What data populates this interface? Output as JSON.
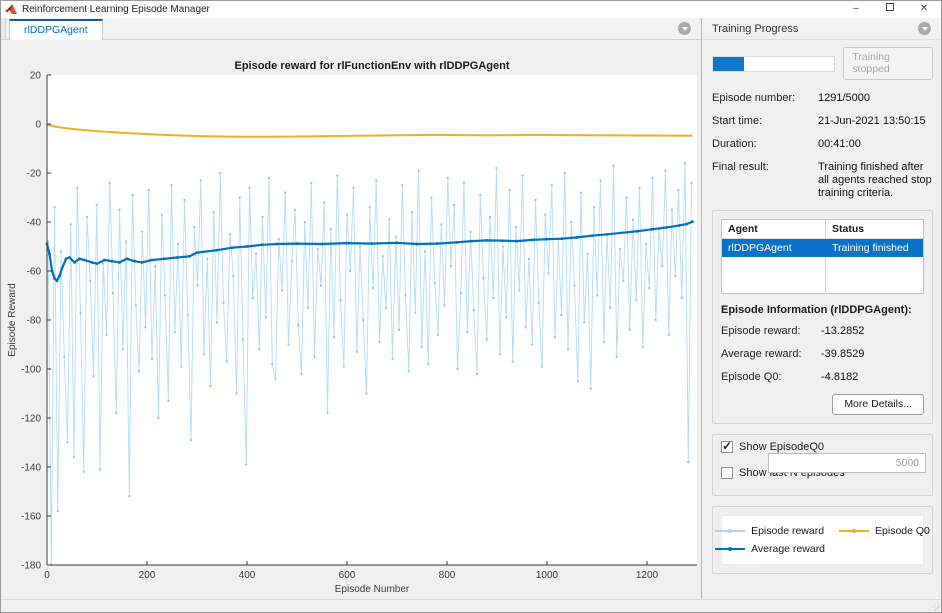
{
  "window": {
    "title": "Reinforcement Learning Episode Manager",
    "controls": {
      "minimize": "–",
      "close": "✕"
    }
  },
  "tabs": [
    {
      "label": "rlDDPGAgent"
    }
  ],
  "chart_data": {
    "type": "line",
    "title": "Episode reward for rlFunctionEnv with rlDDPGAgent",
    "xlabel": "Episode Number",
    "ylabel": "Episode Reward",
    "xlim": [
      0,
      1300
    ],
    "ylim": [
      -180,
      20
    ],
    "x_ticks": [
      0,
      200,
      400,
      600,
      800,
      1000,
      1200
    ],
    "y_ticks": [
      20,
      0,
      -20,
      -40,
      -60,
      -80,
      -100,
      -120,
      -140,
      -160,
      -180
    ],
    "grid": false,
    "legend_position": "right-panel",
    "series": [
      {
        "name": "Episode reward",
        "style": "line-with-markers",
        "x_start": 2,
        "x_step": 6.5,
        "values": [
          -48,
          -180,
          -34,
          -158,
          -52,
          -95,
          -130,
          -41,
          -136,
          -26,
          -77,
          -142,
          -38,
          -64,
          -103,
          -33,
          -141,
          -57,
          -86,
          -24,
          -69,
          -118,
          -35,
          -92,
          -48,
          -152,
          -29,
          -74,
          -101,
          -44,
          -83,
          -27,
          -96,
          -58,
          -120,
          -37,
          -70,
          -113,
          -25,
          -85,
          -49,
          -99,
          -31,
          -78,
          -129,
          -42,
          -66,
          -23,
          -94,
          -55,
          -107,
          -36,
          -81,
          -20,
          -73,
          -97,
          -45,
          -62,
          -110,
          -30,
          -88,
          -139,
          -26,
          -71,
          -53,
          -92,
          -38,
          -79,
          -22,
          -98,
          -104,
          -47,
          -68,
          -28,
          -90,
          -56,
          -35,
          -82,
          -102,
          -40,
          -75,
          -24,
          -95,
          -51,
          -66,
          -32,
          -118,
          -43,
          -87,
          -21,
          -72,
          -99,
          -37,
          -60,
          -26,
          -93,
          -50,
          -80,
          -110,
          -34,
          -67,
          -23,
          -89,
          -54,
          -75,
          -39,
          -96,
          -46,
          -84,
          -25,
          -70,
          -101,
          -36,
          -77,
          -19,
          -91,
          -52,
          -98,
          -30,
          -65,
          -86,
          -41,
          -74,
          -22,
          -58,
          -33,
          -100,
          -69,
          -24,
          -85,
          -44,
          -76,
          -102,
          -29,
          -63,
          -88,
          -38,
          -71,
          -18,
          -94,
          -50,
          -79,
          -27,
          -97,
          -42,
          -68,
          -21,
          -83,
          -55,
          -90,
          -31,
          -73,
          -99,
          -37,
          -61,
          -25,
          -87,
          -47,
          -78,
          -20,
          -92,
          -40,
          -66,
          -105,
          -28,
          -81,
          -53,
          -108,
          -34,
          -70,
          -23,
          -89,
          -45,
          -75,
          -17,
          -95,
          -51,
          -64,
          -30,
          -84,
          -39,
          -72,
          -26,
          -91,
          -49,
          -67,
          -22,
          -80,
          -43,
          -58,
          -19,
          -86,
          -35,
          -62,
          -27,
          -71,
          -16,
          -138,
          -24
        ]
      },
      {
        "name": "Average reward",
        "style": "beaded-line",
        "points": [
          [
            0,
            -49
          ],
          [
            5,
            -53
          ],
          [
            10,
            -60
          ],
          [
            15,
            -63
          ],
          [
            20,
            -64
          ],
          [
            25,
            -62
          ],
          [
            30,
            -59
          ],
          [
            38,
            -55
          ],
          [
            45,
            -54.5
          ],
          [
            55,
            -56.5
          ],
          [
            65,
            -55
          ],
          [
            75,
            -55.5
          ],
          [
            90,
            -56.5
          ],
          [
            100,
            -57
          ],
          [
            115,
            -55.5
          ],
          [
            130,
            -56
          ],
          [
            145,
            -56.5
          ],
          [
            160,
            -55
          ],
          [
            175,
            -56
          ],
          [
            190,
            -56.5
          ],
          [
            210,
            -55.5
          ],
          [
            235,
            -55
          ],
          [
            260,
            -54.5
          ],
          [
            285,
            -54
          ],
          [
            300,
            -52.5
          ],
          [
            340,
            -51.5
          ],
          [
            370,
            -50.5
          ],
          [
            400,
            -50
          ],
          [
            430,
            -49.3
          ],
          [
            460,
            -49
          ],
          [
            500,
            -48.8
          ],
          [
            550,
            -49
          ],
          [
            600,
            -48.6
          ],
          [
            650,
            -48.8
          ],
          [
            700,
            -48.5
          ],
          [
            740,
            -49
          ],
          [
            780,
            -48.8
          ],
          [
            820,
            -48.3
          ],
          [
            850,
            -47.8
          ],
          [
            880,
            -47.5
          ],
          [
            910,
            -47.6
          ],
          [
            940,
            -47.8
          ],
          [
            970,
            -47.3
          ],
          [
            1000,
            -47
          ],
          [
            1030,
            -46.8
          ],
          [
            1060,
            -46.3
          ],
          [
            1090,
            -45.6
          ],
          [
            1120,
            -45
          ],
          [
            1150,
            -44.4
          ],
          [
            1180,
            -43.8
          ],
          [
            1210,
            -43
          ],
          [
            1240,
            -42.2
          ],
          [
            1265,
            -41.4
          ],
          [
            1280,
            -40.8
          ],
          [
            1291,
            -39.8529
          ]
        ]
      },
      {
        "name": "Episode Q0",
        "style": "line",
        "points": [
          [
            0,
            -0.3
          ],
          [
            20,
            -1.2
          ],
          [
            40,
            -1.8
          ],
          [
            60,
            -2.2
          ],
          [
            80,
            -2.6
          ],
          [
            100,
            -2.9
          ],
          [
            130,
            -3.3
          ],
          [
            160,
            -3.7
          ],
          [
            200,
            -4.1
          ],
          [
            240,
            -4.5
          ],
          [
            280,
            -4.8
          ],
          [
            320,
            -5.0
          ],
          [
            360,
            -5.15
          ],
          [
            400,
            -5.2
          ],
          [
            440,
            -5.2
          ],
          [
            480,
            -5.15
          ],
          [
            520,
            -5.05
          ],
          [
            560,
            -4.95
          ],
          [
            600,
            -4.85
          ],
          [
            640,
            -4.75
          ],
          [
            680,
            -4.65
          ],
          [
            720,
            -4.55
          ],
          [
            760,
            -4.5
          ],
          [
            800,
            -4.5
          ],
          [
            840,
            -4.55
          ],
          [
            880,
            -4.6
          ],
          [
            920,
            -4.55
          ],
          [
            960,
            -4.5
          ],
          [
            1000,
            -4.5
          ],
          [
            1040,
            -4.55
          ],
          [
            1100,
            -4.6
          ],
          [
            1150,
            -4.65
          ],
          [
            1200,
            -4.7
          ],
          [
            1250,
            -4.75
          ],
          [
            1291,
            -4.8182
          ]
        ]
      }
    ]
  },
  "training_progress": {
    "header": "Training Progress",
    "progress_percent": 25.8,
    "stop_button_label": "Training stopped",
    "fields": [
      {
        "label": "Episode number:",
        "value": "1291/5000"
      },
      {
        "label": "Start time:",
        "value": "21-Jun-2021 13:50:15"
      },
      {
        "label": "Duration:",
        "value": "00:41:00"
      },
      {
        "label": "Final result:",
        "value": "Training finished after all agents reached stop training criteria."
      }
    ]
  },
  "agent_table": {
    "columns": [
      "Agent",
      "Status"
    ],
    "rows": [
      [
        "rlDDPGAgent",
        "Training finished"
      ]
    ]
  },
  "episode_info": {
    "heading": "Episode Information (rlDDPGAgent):",
    "rows": [
      {
        "label": "Episode reward:",
        "value": "-13.2852"
      },
      {
        "label": "Average reward:",
        "value": "-39.8529"
      },
      {
        "label": "Episode Q0:",
        "value": "-4.8182"
      }
    ],
    "more_details_label": "More Details..."
  },
  "options": {
    "show_episode_q0": {
      "label": "Show EpisodeQ0",
      "checked": true
    },
    "show_last_n": {
      "label": "Show last N episodes",
      "checked": false,
      "value": "5000"
    }
  },
  "legend": [
    {
      "label": "Episode reward",
      "color": "#aad4f0"
    },
    {
      "label": "Average reward",
      "color": "#0072bd"
    },
    {
      "label": "Episode Q0",
      "color": "#edb120"
    }
  ],
  "colors": {
    "episode_reward_line": "#b4dcf6",
    "episode_reward_marker": "#8cc5ec",
    "average_reward": "#0072bd",
    "episode_q0": "#edb120",
    "selection": "#0a72c8",
    "progress_fill": "#1077c8",
    "axis": "#3c3c3c"
  }
}
